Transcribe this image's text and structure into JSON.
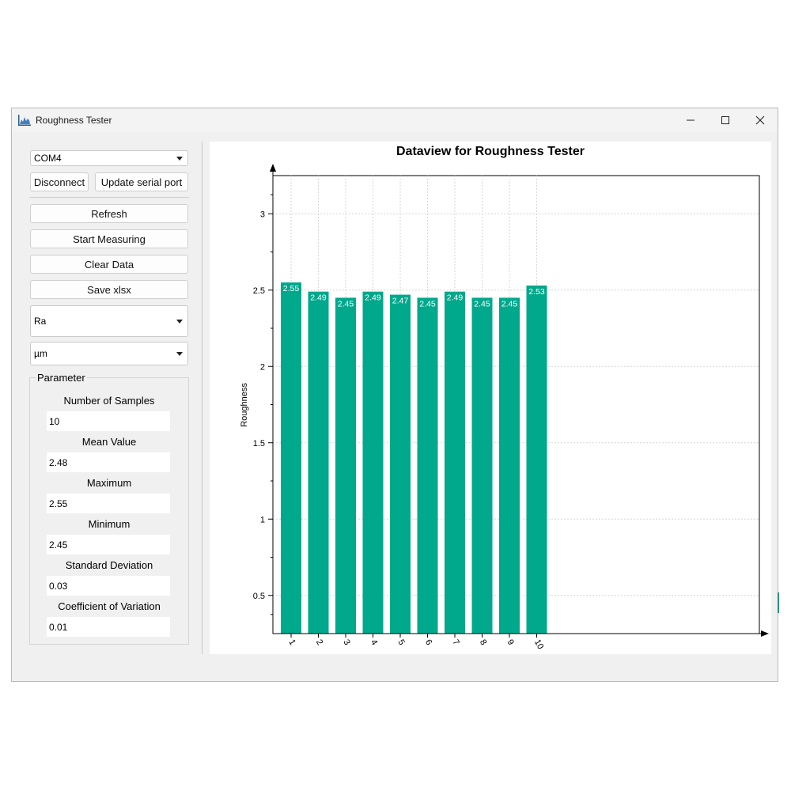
{
  "window": {
    "title": "Roughness Tester"
  },
  "controls": {
    "port": "COM4",
    "disconnect": "Disconnect",
    "update_port": "Update serial port",
    "refresh": "Refresh",
    "start": "Start Measuring",
    "clear": "Clear Data",
    "save": "Save xlsx",
    "parameter_type": "Ra",
    "unit": "µm"
  },
  "parameter": {
    "title": "Parameter",
    "items": [
      {
        "label": "Number of Samples",
        "value": "10"
      },
      {
        "label": "Mean Value",
        "value": "2.48"
      },
      {
        "label": "Maximum",
        "value": "2.55"
      },
      {
        "label": "Minimum",
        "value": "2.45"
      },
      {
        "label": "Standard Deviation",
        "value": "0.03"
      },
      {
        "label": "Coefficient of Variation",
        "value": "0.01"
      }
    ]
  },
  "colors": {
    "bar": "#00a88c",
    "accent": "#00a88c"
  },
  "chart_data": {
    "type": "bar",
    "title": "Dataview for Roughness Tester",
    "ylabel": "Roughness",
    "xlabel": "",
    "categories": [
      "1",
      "2",
      "3",
      "4",
      "5",
      "6",
      "7",
      "8",
      "9",
      "10"
    ],
    "values": [
      2.55,
      2.49,
      2.45,
      2.49,
      2.47,
      2.45,
      2.49,
      2.45,
      2.45,
      2.53
    ],
    "value_labels": [
      "2.55",
      "2.49",
      "2.45",
      "2.49",
      "2.47",
      "2.45",
      "2.49",
      "2.45",
      "2.45",
      "2.53"
    ],
    "yticks": [
      "0.5",
      "1",
      "1.5",
      "2",
      "2.5",
      "3"
    ],
    "ylim": [
      0.25,
      3.25
    ],
    "grid": true,
    "legend": "none"
  }
}
